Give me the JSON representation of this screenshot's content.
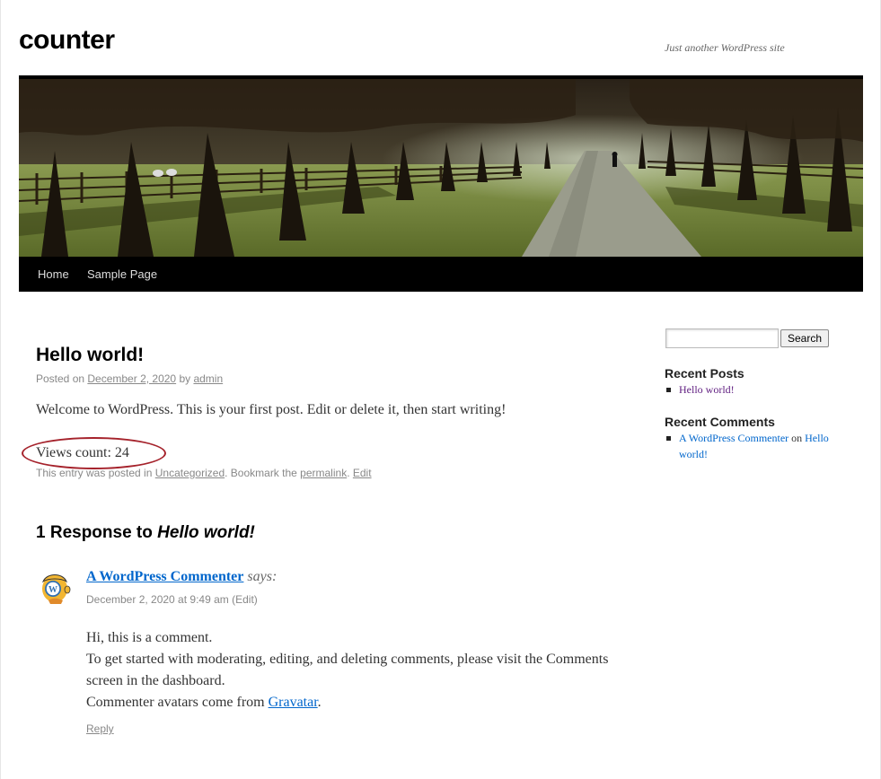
{
  "site": {
    "title": "counter",
    "description": "Just another WordPress site"
  },
  "nav": {
    "items": [
      "Home",
      "Sample Page"
    ]
  },
  "post": {
    "title": "Hello world!",
    "meta_posted_on": "Posted on ",
    "meta_date": "December 2, 2020",
    "meta_by": " by ",
    "meta_author": "admin",
    "body": "Welcome to WordPress. This is your first post. Edit or delete it, then start writing!",
    "views": "Views count: 24",
    "footer_prefix": "This entry was posted in ",
    "footer_category": "Uncategorized",
    "footer_middle": ". Bookmark the ",
    "footer_permalink": "permalink",
    "footer_sep": ". ",
    "footer_edit": "Edit"
  },
  "responses": {
    "prefix": "1 Response to ",
    "title": "Hello world!"
  },
  "comment": {
    "author": "A WordPress Commenter",
    "says": "says:",
    "date": "December 2, 2020 at 9:49 am",
    "edit": "(Edit)",
    "line1": "Hi, this is a comment.",
    "line2": "To get started with moderating, editing, and deleting comments, please visit the Comments screen in the dashboard.",
    "line3_prefix": "Commenter avatars come from ",
    "line3_link": "Gravatar",
    "line3_suffix": ".",
    "reply": "Reply"
  },
  "sidebar": {
    "search_button": "Search",
    "search_placeholder": "",
    "recent_posts_title": "Recent Posts",
    "recent_posts": [
      "Hello world!"
    ],
    "recent_comments_title": "Recent Comments",
    "recent_comment_author": "A WordPress Commenter",
    "recent_comment_on": " on ",
    "recent_comment_post": "Hello world!"
  },
  "colors": {
    "link": "#0066cc",
    "visited": "#5f1d80",
    "annotation_ring": "#a5222b"
  }
}
